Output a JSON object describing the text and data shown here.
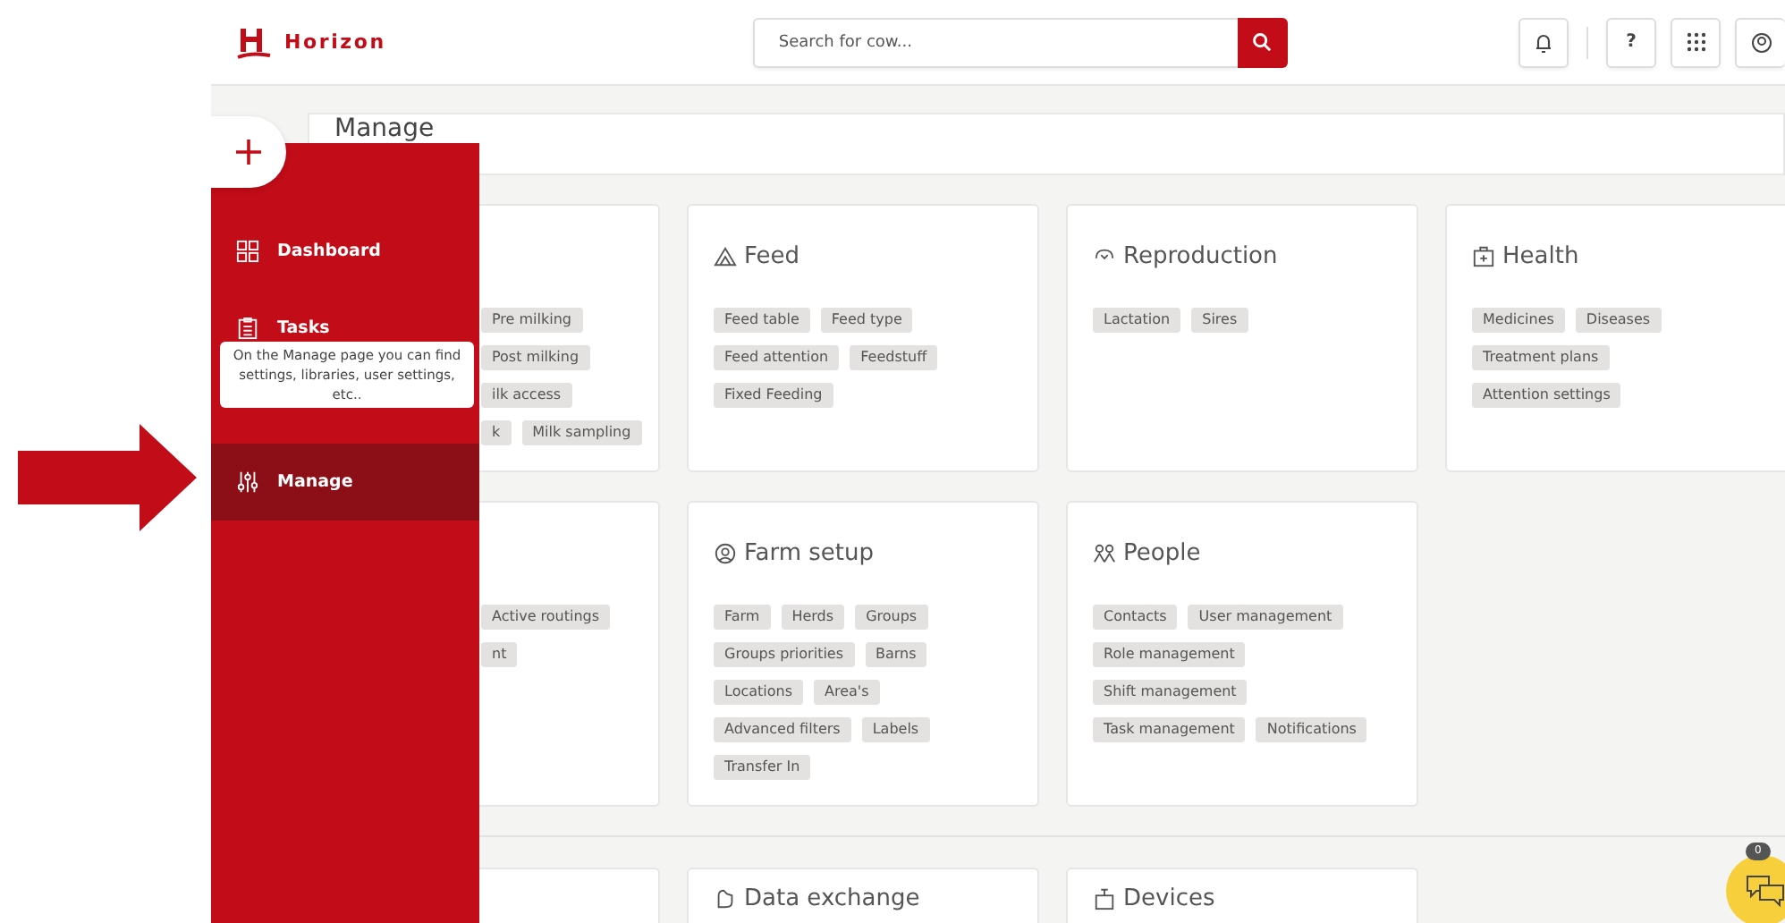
{
  "header": {
    "logo_text": "Horizon",
    "search": {
      "placeholder": "Search for cow..."
    },
    "help_label": "?"
  },
  "page_title": "Manage",
  "sidebar": {
    "items": [
      {
        "kind": "dashboard",
        "label": "Dashboard",
        "selected": false
      },
      {
        "kind": "tasks",
        "label": "Tasks",
        "selected": false
      },
      {
        "kind": "hidden"
      },
      {
        "kind": "manage",
        "label": "Manage",
        "selected": true
      }
    ],
    "tooltip": "On the Manage page you can find settings, libraries, user settings, etc.."
  },
  "card_rows": [
    [
      {
        "chip_rows": [
          [
            "Pre milking"
          ],
          [
            "Post milking"
          ],
          [
            "ilk access"
          ],
          [
            "k",
            "Milk sampling"
          ]
        ]
      },
      {
        "title": "Feed",
        "kind": "feed",
        "chip_rows": [
          [
            "Feed table",
            "Feed type"
          ],
          [
            "Feed attention",
            "Feedstuff"
          ],
          [
            "Fixed Feeding"
          ]
        ]
      },
      {
        "title": "Reproduction",
        "kind": "reproduction",
        "chip_rows": [
          [
            "Lactation",
            "Sires"
          ]
        ]
      },
      {
        "title": "Health",
        "kind": "health",
        "chip_rows": [
          [
            "Medicines",
            "Diseases"
          ],
          [
            "Treatment plans"
          ],
          [
            "Attention settings"
          ]
        ]
      }
    ],
    [
      {
        "chip_rows": [
          [
            "Active routings"
          ],
          [
            "nt"
          ]
        ]
      },
      {
        "title": "Farm setup",
        "kind": "farm",
        "chip_rows": [
          [
            "Farm",
            "Herds",
            "Groups"
          ],
          [
            "Groups priorities",
            "Barns"
          ],
          [
            "Locations",
            "Area's"
          ],
          [
            "Advanced filters",
            "Labels"
          ],
          [
            "Transfer In"
          ]
        ]
      },
      {
        "title": "People",
        "kind": "people",
        "chip_rows": [
          [
            "Contacts",
            "User management"
          ],
          [
            "Role management"
          ],
          [
            "Shift management"
          ],
          [
            "Task management",
            "Notifications"
          ]
        ]
      }
    ],
    [
      {},
      {
        "title": "Data exchange",
        "kind": "exchange"
      },
      {
        "title": "Devices",
        "kind": "devices"
      }
    ]
  ],
  "help_badge": "0"
}
